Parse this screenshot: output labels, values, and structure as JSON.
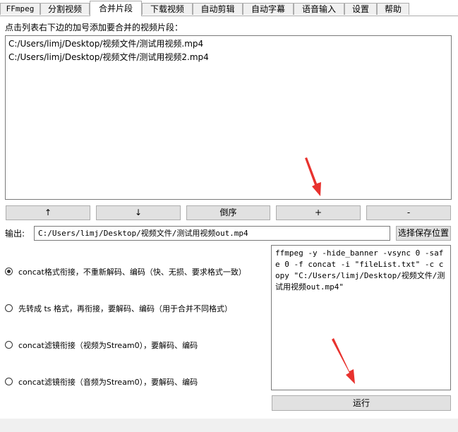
{
  "tabs": [
    {
      "label": "FFmpeg",
      "active": false
    },
    {
      "label": "分割视频",
      "active": false
    },
    {
      "label": "合并片段",
      "active": true
    },
    {
      "label": "下载视频",
      "active": false
    },
    {
      "label": "自动剪辑",
      "active": false
    },
    {
      "label": "自动字幕",
      "active": false
    },
    {
      "label": "语音输入",
      "active": false
    },
    {
      "label": "设置",
      "active": false
    },
    {
      "label": "帮助",
      "active": false
    }
  ],
  "merge": {
    "instruction": "点击列表右下边的加号添加要合并的视频片段：",
    "files": [
      "C:/Users/limj/Desktop/视频文件/测试用视频.mp4",
      "C:/Users/limj/Desktop/视频文件/测试用视频2.mp4"
    ],
    "buttons": {
      "up": "↑",
      "down": "↓",
      "reverse": "倒序",
      "add": "+",
      "remove": "-"
    },
    "output_label": "输出:",
    "output_value": "C:/Users/limj/Desktop/视频文件/测试用视频out.mp4",
    "choose_location": "选择保存位置",
    "options": [
      {
        "label": "concat格式衔接，不重新解码、编码（快、无损、要求格式一致）",
        "selected": true
      },
      {
        "label": "先转成 ts 格式，再衔接，要解码、编码（用于合并不同格式）",
        "selected": false
      },
      {
        "label": "concat滤镜衔接（视频为Stream0），要解码、编码",
        "selected": false
      },
      {
        "label": "concat滤镜衔接（音频为Stream0），要解码、编码",
        "selected": false
      }
    ],
    "command": "ffmpeg -y -hide_banner -vsync 0 -safe 0 -f concat -i \"fileList.txt\" -c copy \"C:/Users/limj/Desktop/视频文件/测试用视频out.mp4\"",
    "run": "运行"
  },
  "colors": {
    "arrow": "#e8322e",
    "window_bg": "#ffffff",
    "button_bg": "#e1e1e1"
  }
}
